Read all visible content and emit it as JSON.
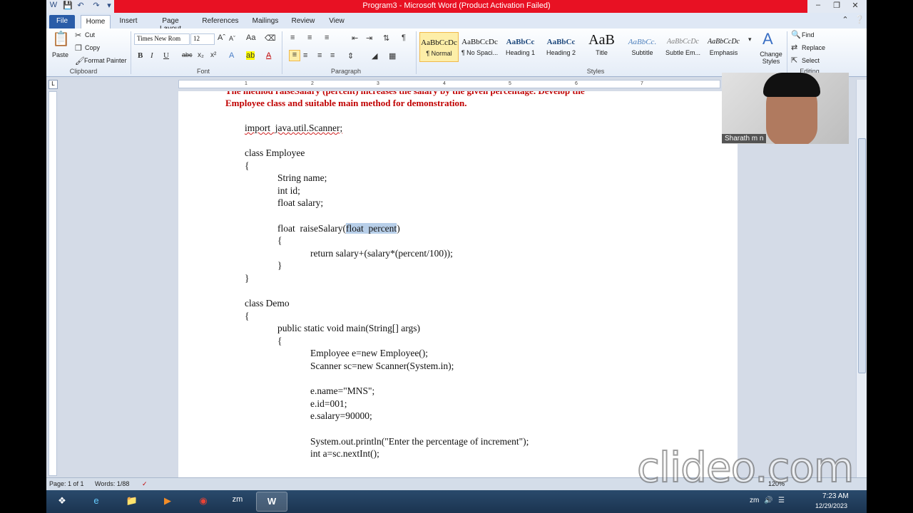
{
  "window": {
    "title": "Program3 - Microsoft Word (Product Activation Failed)"
  },
  "tabs": [
    "File",
    "Home",
    "Insert",
    "Page Layout",
    "References",
    "Mailings",
    "Review",
    "View"
  ],
  "clipboard": {
    "paste": "Paste",
    "cut": "Cut",
    "copy": "Copy",
    "format_painter": "Format Painter",
    "label": "Clipboard"
  },
  "font": {
    "name": "Times New Rom",
    "size": "12",
    "label": "Font"
  },
  "paragraph": {
    "label": "Paragraph"
  },
  "styles": {
    "label": "Styles",
    "items": [
      {
        "preview": "AaBbCcDc",
        "name": "¶ Normal"
      },
      {
        "preview": "AaBbCcDc",
        "name": "¶ No Spaci..."
      },
      {
        "preview": "AaBbCc",
        "name": "Heading 1"
      },
      {
        "preview": "AaBbCc",
        "name": "Heading 2"
      },
      {
        "preview": "AaB",
        "name": "Title"
      },
      {
        "preview": "AaBbCc.",
        "name": "Subtitle"
      },
      {
        "preview": "AaBbCcDc",
        "name": "Subtle Em..."
      },
      {
        "preview": "AaBbCcDc",
        "name": "Emphasis"
      }
    ],
    "change_styles": "Change Styles"
  },
  "editing": {
    "find": "Find",
    "replace": "Replace",
    "select": "Select",
    "label": "Editing"
  },
  "document": {
    "heading1": "The method raiseSalary (percent) increases the salary by the given percentage. Develop the",
    "heading2": "Employee class and suitable main method for demonstration.",
    "lines": [
      "import  java.util.Scanner;",
      "class Employee",
      "{",
      "String name;",
      "int id;",
      "float salary;",
      "float  raiseSalary(",
      "float  percent",
      ")",
      "{",
      "return salary+(salary*(percent/100));",
      "}",
      "}",
      "class Demo",
      "{",
      "public static void main(String[] args)",
      "{",
      "Employee e=new Employee();",
      "Scanner sc=new Scanner(System.in);",
      "e.name=\"MNS\";",
      "e.id=001;",
      "e.salary=90000;",
      "System.out.println(\"Enter the percentage of increment\");",
      "int a=sc.nextInt();"
    ]
  },
  "status": {
    "page": "Page: 1 of 1",
    "words": "Words: 1/88",
    "zoom": "120%"
  },
  "taskbar": {
    "time": "7:23 AM",
    "date": "12/29/2023"
  },
  "webcam": {
    "name": "Sharath m n"
  },
  "watermark": "clideo.com",
  "colors": {
    "title_red": "#e81123",
    "heading_red": "#c00000",
    "selection": "#b8cfe9"
  }
}
